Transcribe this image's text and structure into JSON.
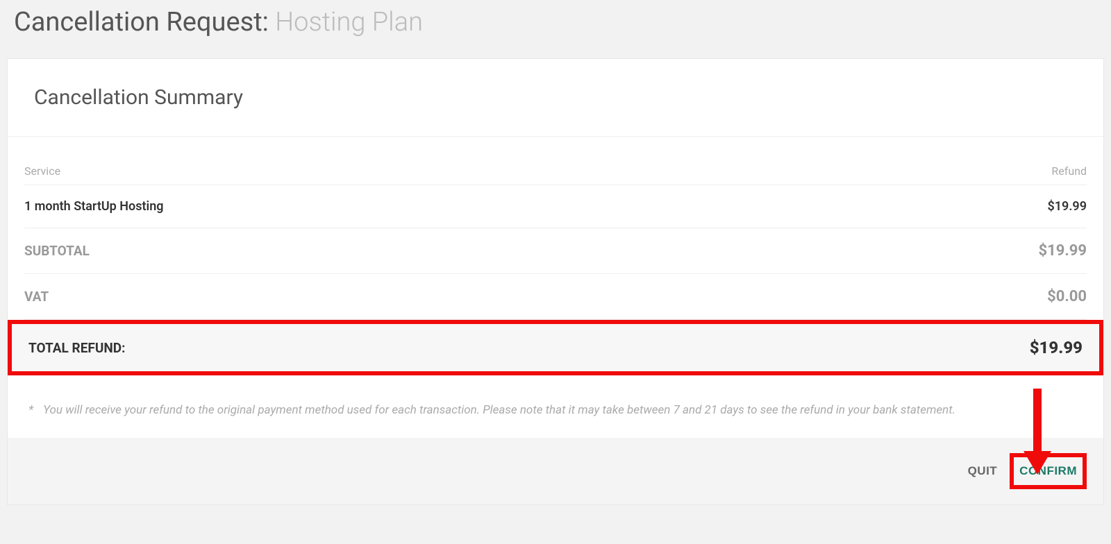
{
  "header": {
    "title_prefix": "Cancellation Request: ",
    "title_sub": "Hosting Plan"
  },
  "card": {
    "title": "Cancellation Summary"
  },
  "table": {
    "col_service": "Service",
    "col_refund": "Refund",
    "item_name": "1 month StartUp Hosting",
    "item_refund": "$19.99",
    "subtotal_label": "SUBTOTAL",
    "subtotal_value": "$19.99",
    "vat_label": "VAT",
    "vat_value": "$0.00",
    "total_label": "TOTAL REFUND:",
    "total_value": "$19.99"
  },
  "note": {
    "star": "*",
    "text": "You will receive your refund to the original payment method used for each transaction. Please note that it may take between 7 and 21 days to see the refund in your bank statement."
  },
  "footer": {
    "quit_label": "QUIT",
    "confirm_label": "CONFIRM"
  }
}
